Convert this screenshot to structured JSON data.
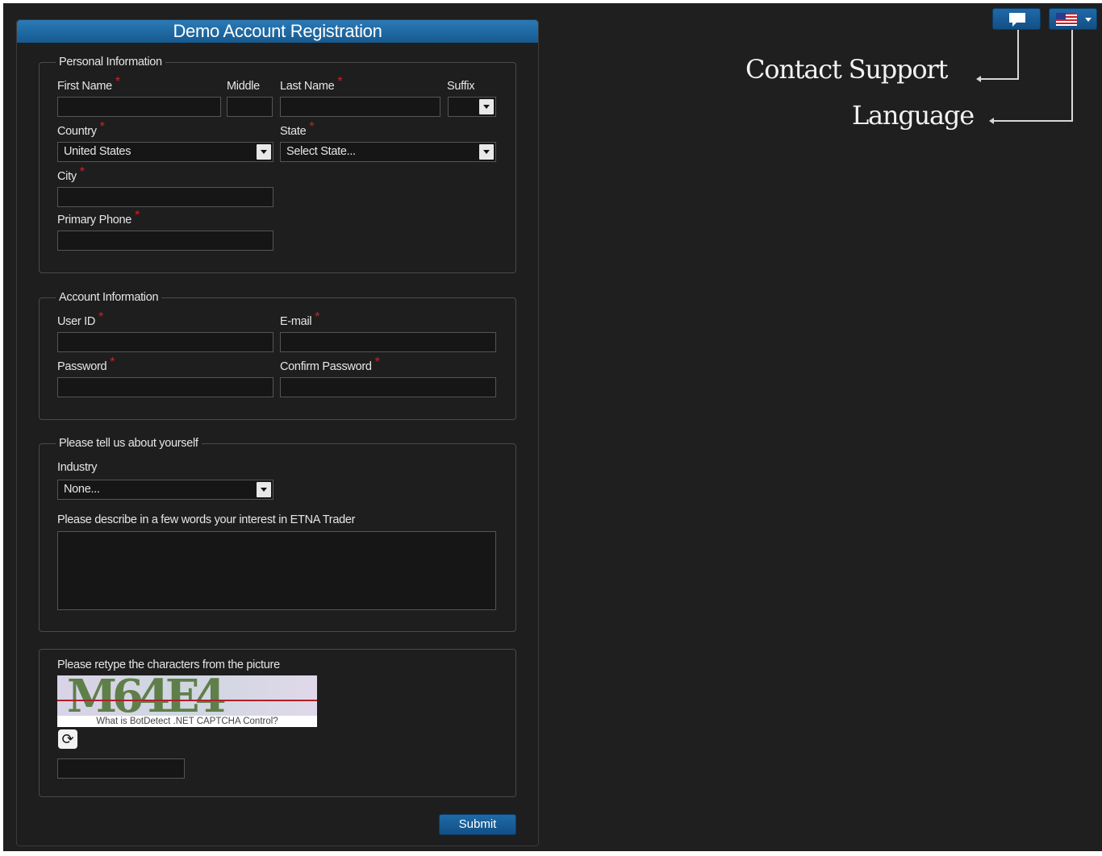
{
  "form": {
    "title": "Demo Account Registration",
    "personal": {
      "legend": "Personal Information",
      "first_name_label": "First Name",
      "middle_label": "Middle",
      "last_name_label": "Last Name",
      "suffix_label": "Suffix",
      "country_label": "Country",
      "country_value": "United States",
      "state_label": "State",
      "state_value": "Select State...",
      "city_label": "City",
      "phone_label": "Primary Phone"
    },
    "account": {
      "legend": "Account Information",
      "user_id_label": "User ID",
      "email_label": "E-mail",
      "password_label": "Password",
      "confirm_password_label": "Confirm Password"
    },
    "about": {
      "legend": "Please tell us about yourself",
      "industry_label": "Industry",
      "industry_value": "None...",
      "interest_label": "Please describe in a few words your interest in ETNA Trader"
    },
    "captcha": {
      "label": "Please retype the characters from the picture",
      "characters": "M64E4",
      "link_text": "What is BotDetect .NET CAPTCHA Control?"
    },
    "required_marker": "*",
    "submit_label": "Submit"
  },
  "top_buttons": {
    "support_icon": "chat-bubble-icon",
    "language_icon": "us-flag-icon",
    "language_caret": "caret-down-icon"
  },
  "annotations": {
    "contact_support": "Contact Support",
    "language": "Language"
  },
  "colors": {
    "background": "#1f1f1f",
    "header_blue": "#1f6aa8",
    "required": "#d42020"
  }
}
